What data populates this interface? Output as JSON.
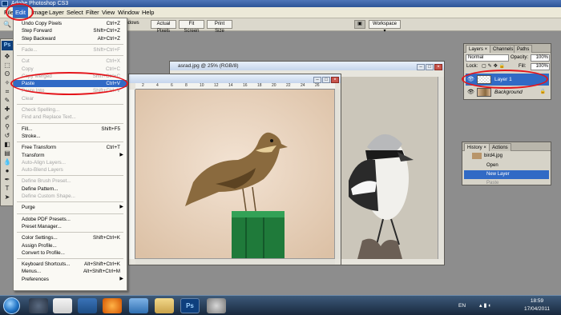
{
  "app": {
    "title": "Adobe Photoshop CS3"
  },
  "menubar": {
    "items": [
      "File",
      "Edit",
      "Image",
      "Layer",
      "Select",
      "Filter",
      "View",
      "Window",
      "Help"
    ]
  },
  "options": {
    "windows": "indows",
    "actual_pixels": "Actual Pixels",
    "fit_screen": "Fit Screen",
    "print_size": "Print Size",
    "workspace": "Workspace ▾"
  },
  "edit_menu": {
    "items": [
      {
        "label": "Undo Copy Pixels",
        "shortcut": "Ctrl+Z",
        "disabled": false
      },
      {
        "label": "Step Forward",
        "shortcut": "Shift+Ctrl+Z",
        "disabled": false
      },
      {
        "label": "Step Backward",
        "shortcut": "Alt+Ctrl+Z",
        "disabled": false
      },
      {
        "sep": true
      },
      {
        "label": "Fade...",
        "shortcut": "Shift+Ctrl+F",
        "disabled": true
      },
      {
        "sep": true
      },
      {
        "label": "Cut",
        "shortcut": "Ctrl+X",
        "disabled": true
      },
      {
        "label": "Copy",
        "shortcut": "Ctrl+C",
        "disabled": true
      },
      {
        "label": "Copy Merged",
        "shortcut": "Shift+Ctrl+C",
        "disabled": true
      },
      {
        "label": "Paste",
        "shortcut": "Ctrl+V",
        "disabled": false,
        "highlighted": true
      },
      {
        "label": "Paste Into",
        "shortcut": "Shift+Ctrl+V",
        "disabled": true
      },
      {
        "label": "Clear",
        "shortcut": "",
        "disabled": true
      },
      {
        "sep": true
      },
      {
        "label": "Check Spelling...",
        "shortcut": "",
        "disabled": true
      },
      {
        "label": "Find and Replace Text...",
        "shortcut": "",
        "disabled": true
      },
      {
        "sep": true
      },
      {
        "label": "Fill...",
        "shortcut": "Shift+F5",
        "disabled": false
      },
      {
        "label": "Stroke...",
        "shortcut": "",
        "disabled": false
      },
      {
        "sep": true
      },
      {
        "label": "Free Transform",
        "shortcut": "Ctrl+T",
        "disabled": false
      },
      {
        "label": "Transform",
        "shortcut": "",
        "disabled": false,
        "submenu": true
      },
      {
        "label": "Auto-Align Layers...",
        "shortcut": "",
        "disabled": true
      },
      {
        "label": "Auto-Blend Layers",
        "shortcut": "",
        "disabled": true
      },
      {
        "sep": true
      },
      {
        "label": "Define Brush Preset...",
        "shortcut": "",
        "disabled": true
      },
      {
        "label": "Define Pattern...",
        "shortcut": "",
        "disabled": false
      },
      {
        "label": "Define Custom Shape...",
        "shortcut": "",
        "disabled": true
      },
      {
        "sep": true
      },
      {
        "label": "Purge",
        "shortcut": "",
        "disabled": false,
        "submenu": true
      },
      {
        "sep": true
      },
      {
        "label": "Adobe PDF Presets...",
        "shortcut": "",
        "disabled": false
      },
      {
        "label": "Preset Manager...",
        "shortcut": "",
        "disabled": false
      },
      {
        "sep": true
      },
      {
        "label": "Color Settings...",
        "shortcut": "Shift+Ctrl+K",
        "disabled": false
      },
      {
        "label": "Assign Profile...",
        "shortcut": "",
        "disabled": false
      },
      {
        "label": "Convert to Profile...",
        "shortcut": "",
        "disabled": false
      },
      {
        "sep": true
      },
      {
        "label": "Keyboard Shortcuts...",
        "shortcut": "Alt+Shift+Ctrl+K",
        "disabled": false
      },
      {
        "label": "Menus...",
        "shortcut": "Alt+Shift+Ctrl+M",
        "disabled": false
      },
      {
        "label": "Preferences",
        "shortcut": "",
        "disabled": false,
        "submenu": true
      }
    ]
  },
  "documents": {
    "back": {
      "title": "asrad.jpg @ 25% (RGB/8)"
    },
    "front": {
      "title": "",
      "ruler_marks": [
        "2",
        "4",
        "6",
        "8",
        "10",
        "12",
        "14",
        "16",
        "18",
        "20",
        "22",
        "24",
        "26"
      ]
    }
  },
  "layers_panel": {
    "tabs": [
      "Layers ×",
      "Channels",
      "Paths"
    ],
    "blend_mode": "Normal",
    "opacity_label": "Opacity:",
    "opacity_value": "100%",
    "lock_label": "Lock:",
    "fill_label": "Fill:",
    "fill_value": "100%",
    "layers": [
      {
        "name": "Layer 1",
        "selected": true
      },
      {
        "name": "Background",
        "selected": false
      }
    ]
  },
  "history_panel": {
    "tabs": [
      "History ×",
      "Actions"
    ],
    "snapshot": "bird4.jpg",
    "items": [
      "Open",
      "New Layer",
      "Paste"
    ]
  },
  "taskbar": {
    "language": "EN",
    "time": "18:59",
    "date": "17/04/2011"
  },
  "colors": {
    "highlight": "#316ac5",
    "annotation": "#e4151b"
  }
}
